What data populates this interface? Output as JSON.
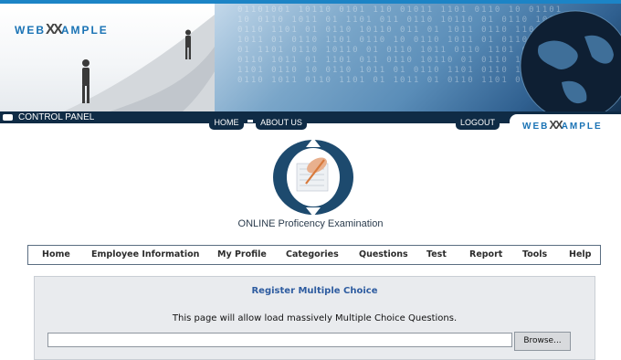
{
  "brand": {
    "logo_left": "WEB",
    "logo_mark": "XX",
    "logo_right": "AMPLE"
  },
  "control_bar": {
    "label": "CONTROL PANEL",
    "tabs": [
      "HOME",
      "ABOUT US"
    ],
    "logout": "LOGOUT"
  },
  "exam": {
    "title": "ONLINE Proficency Examination"
  },
  "menu": {
    "items": [
      "Home",
      "Employee Information",
      "My Profile",
      "Categories",
      "Questions",
      "Test",
      "Report",
      "Tools",
      "Help"
    ]
  },
  "content": {
    "title": "Register Multiple Choice",
    "description": "This page will allow load massively Multiple Choice Questions.",
    "file_value": "",
    "browse_label": "Browse..."
  },
  "colors": {
    "navy": "#0f2b45",
    "accent_blue": "#1c84c6",
    "title_blue": "#2e5ca0"
  }
}
